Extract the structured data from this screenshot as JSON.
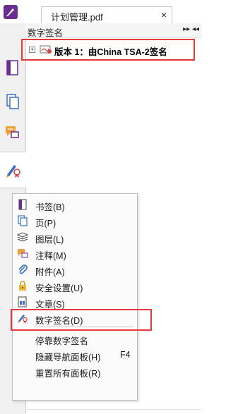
{
  "tab": {
    "title": "计划管理.pdf",
    "close": "×"
  },
  "panel": {
    "title": "数字签名",
    "buttons": "▸▸ ◂◂",
    "signature_expand": "+",
    "signature_label": "版本 1：由China TSA-2签名"
  },
  "rail": {
    "items": [
      {
        "name": "page-thumbnail",
        "active": false
      },
      {
        "name": "pages",
        "active": false
      },
      {
        "name": "comments",
        "active": false
      },
      {
        "name": "digital-signature",
        "active": true
      }
    ]
  },
  "menu": {
    "items": [
      {
        "label": "书签(B)",
        "icon": "bookmark-icon"
      },
      {
        "label": "页(P)",
        "icon": "pages-icon"
      },
      {
        "label": "图层(L)",
        "icon": "layers-icon"
      },
      {
        "label": "注释(M)",
        "icon": "comment-icon"
      },
      {
        "label": "附件(A)",
        "icon": "attachment-icon"
      },
      {
        "label": "安全设置(U)",
        "icon": "lock-icon"
      },
      {
        "label": "文章(S)",
        "icon": "article-icon"
      },
      {
        "label": "数字签名(D)",
        "icon": "signature-icon"
      },
      {
        "label": "停靠数字签名"
      },
      {
        "label": "隐藏导航面板(H)",
        "shortcut": "F4"
      },
      {
        "label": "重置所有面板(R)"
      }
    ]
  },
  "colors": {
    "highlight_red": "#e53a3a",
    "brand_purple": "#6b2d91",
    "icon_orange": "#e9a13b",
    "icon_blue": "#3b6fc9"
  }
}
